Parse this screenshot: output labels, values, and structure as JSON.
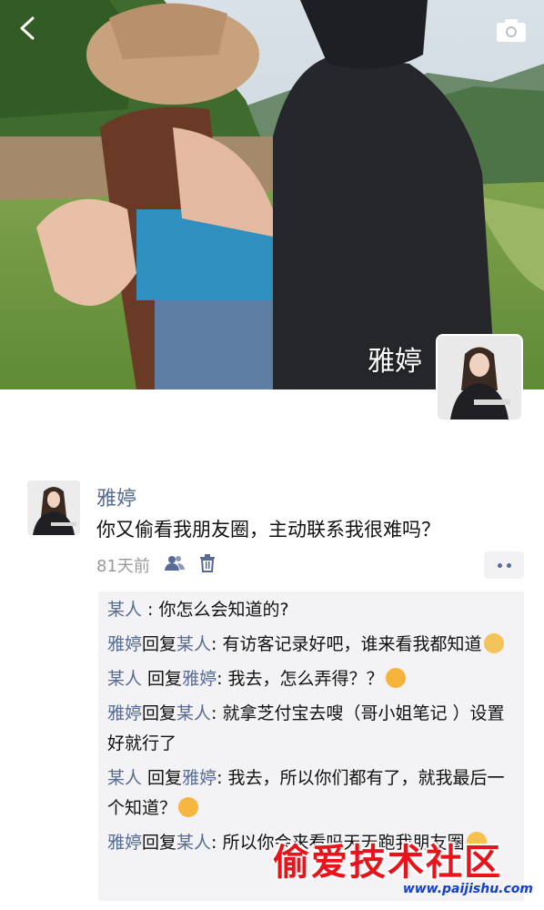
{
  "profile": {
    "name": "雅婷"
  },
  "post": {
    "author": "雅婷",
    "text": "你又偷看我朋友圈，主动联系我很难吗？",
    "time": "81天前"
  },
  "comments": [
    {
      "from": "某人",
      "reply": "",
      "sep": " : ",
      "text": "你怎么会知道的?"
    },
    {
      "from": "雅婷",
      "reply_word": "回复",
      "to": "某人",
      "sep": ": ",
      "text": "有访客记录好吧，谁来看我都知道",
      "emoji": "doge-emoji"
    },
    {
      "from": "某人",
      "reply_word": " 回复",
      "to": "雅婷",
      "sep": ": ",
      "text": "我去，怎么弄得？？",
      "emoji": "666-emoji"
    },
    {
      "from": "雅婷",
      "reply_word": "回复",
      "to": "某人",
      "sep": ": ",
      "text": "就拿芝付宝去嗖（哥小姐笔记 ）设置好就行了"
    },
    {
      "from": "某人",
      "reply_word": " 回复",
      "to": "雅婷",
      "sep": ": ",
      "text": "我去，所以你们都有了，就我最后一个知道？",
      "emoji": "kiss-emoji"
    },
    {
      "from": "雅婷",
      "reply_word": "回复",
      "to": "某人",
      "sep": ": ",
      "text": "所以你会来看吗天天跑我朋友圈",
      "emoji": "smirk-emoji"
    }
  ],
  "watermark": {
    "title": "偷爱技术社区",
    "url": "www.paijishu.com"
  },
  "colors": {
    "link": "#576b95",
    "comment_bg": "#f3f3f5",
    "watermark_red": "#e8131b",
    "watermark_blue": "#1240c8"
  },
  "icons": [
    "back-arrow-icon",
    "camera-icon",
    "friends-visibility-icon",
    "delete-icon",
    "more-dots-icon"
  ]
}
